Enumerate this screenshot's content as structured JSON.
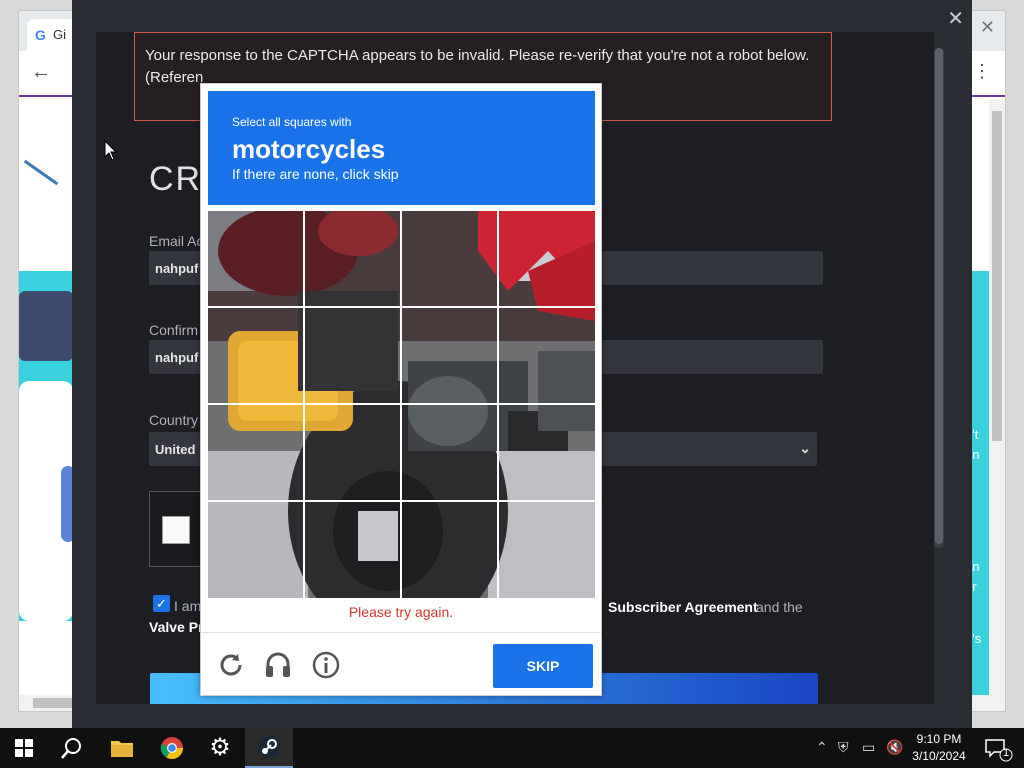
{
  "background_browser": {
    "tab_title": "Gi",
    "right_snippets": [
      "o",
      "n't",
      "en",
      "an",
      "er",
      "d's"
    ]
  },
  "overlay": {
    "error_text": "Your response to the CAPTCHA appears to be invalid. Please re-verify that you're not a robot below.",
    "error_ref": "(Referen",
    "heading": "CRI",
    "email_label": "Email Ac",
    "email_value": "nahpuf",
    "confirm_label": "Confirm",
    "confirm_value": "nahpuf",
    "country_label": "Country",
    "country_value": "United",
    "agree_prefix": "I am",
    "agree_subscriber": "Subscriber Agreement",
    "agree_and": "and the",
    "agree_valve": "Valve Pr"
  },
  "captcha": {
    "instruction_small": "Select all squares with",
    "object": "motorcycles",
    "hint": "If there are none, click skip",
    "error": "Please try again.",
    "skip_label": "SKIP",
    "grid_size": 4
  },
  "taskbar": {
    "time": "9:10 PM",
    "date": "3/10/2024",
    "notification_count": "1"
  }
}
